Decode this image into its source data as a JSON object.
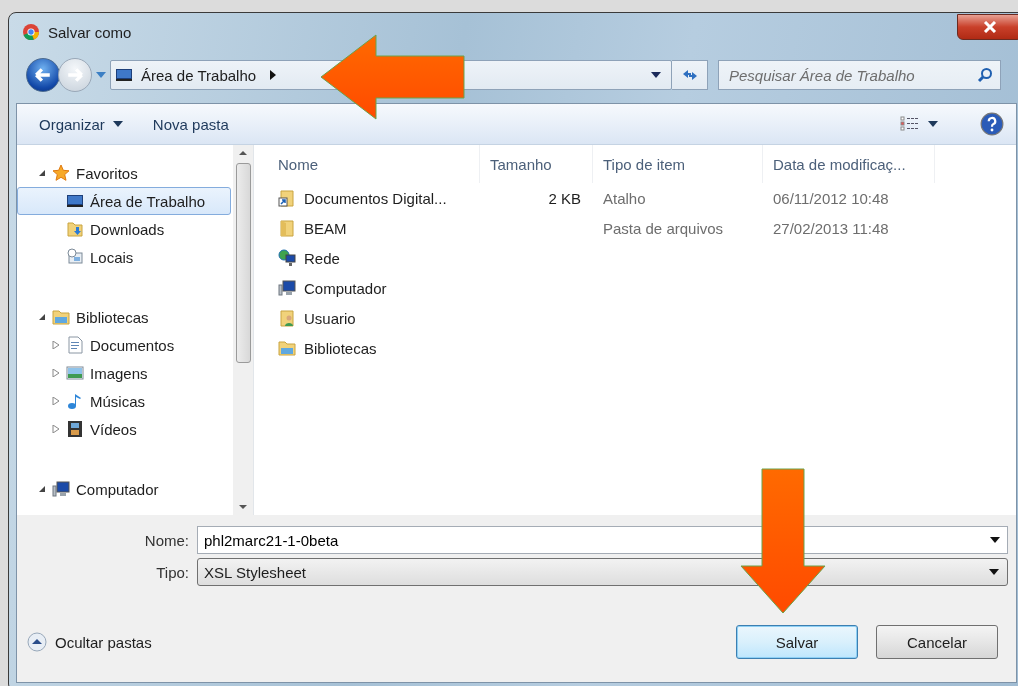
{
  "window": {
    "title": "Salvar como"
  },
  "address_bar": {
    "path": "Área de Trabalho"
  },
  "search": {
    "placeholder": "Pesquisar Área de Trabalho"
  },
  "toolbar": {
    "organize": "Organizar",
    "new_folder": "Nova pasta"
  },
  "sidebar": {
    "sections": [
      {
        "label": "Favoritos",
        "kind": "favorites",
        "expanded": true,
        "selected": false,
        "children": [
          {
            "label": "Área de Trabalho",
            "kind": "desktop",
            "selected": true
          },
          {
            "label": "Downloads",
            "kind": "downloads",
            "selected": false
          },
          {
            "label": "Locais",
            "kind": "places",
            "selected": false
          }
        ]
      },
      {
        "label": "Bibliotecas",
        "kind": "library",
        "expanded": true,
        "selected": false,
        "children": [
          {
            "label": "Documentos",
            "kind": "documents",
            "expanded": false,
            "selected": false
          },
          {
            "label": "Imagens",
            "kind": "pictures",
            "expanded": false,
            "selected": false
          },
          {
            "label": "Músicas",
            "kind": "music",
            "expanded": false,
            "selected": false
          },
          {
            "label": "Vídeos",
            "kind": "videos",
            "expanded": false,
            "selected": false
          }
        ]
      },
      {
        "label": "Computador",
        "kind": "computer",
        "expanded": true,
        "selected": false
      }
    ]
  },
  "file_list": {
    "columns": [
      "Nome",
      "Tamanho",
      "Tipo de item",
      "Data de modificaç..."
    ],
    "rows": [
      {
        "kind": "shortcut",
        "name": "Documentos Digital...",
        "size": "2 KB",
        "type": "Atalho",
        "modified": "06/11/2012 10:48"
      },
      {
        "kind": "folder",
        "name": "BEAM",
        "type": "Pasta de arquivos",
        "modified": "27/02/2013 11:48"
      },
      {
        "kind": "network",
        "name": "Rede"
      },
      {
        "kind": "computer",
        "name": "Computador"
      },
      {
        "kind": "user",
        "name": "Usuario"
      },
      {
        "kind": "library",
        "name": "Bibliotecas"
      }
    ]
  },
  "form": {
    "name_label": "Nome:",
    "name_value": "phl2marc21-1-0beta",
    "type_label": "Tipo:",
    "type_value": "XSL Stylesheet"
  },
  "hide_folders": "Ocultar pastas",
  "buttons": [
    {
      "label": "Salvar",
      "kind": "primary"
    },
    {
      "label": "Cancelar",
      "kind": "secondary"
    }
  ],
  "callouts": [
    {
      "kind": "left"
    },
    {
      "kind": "down"
    }
  ]
}
